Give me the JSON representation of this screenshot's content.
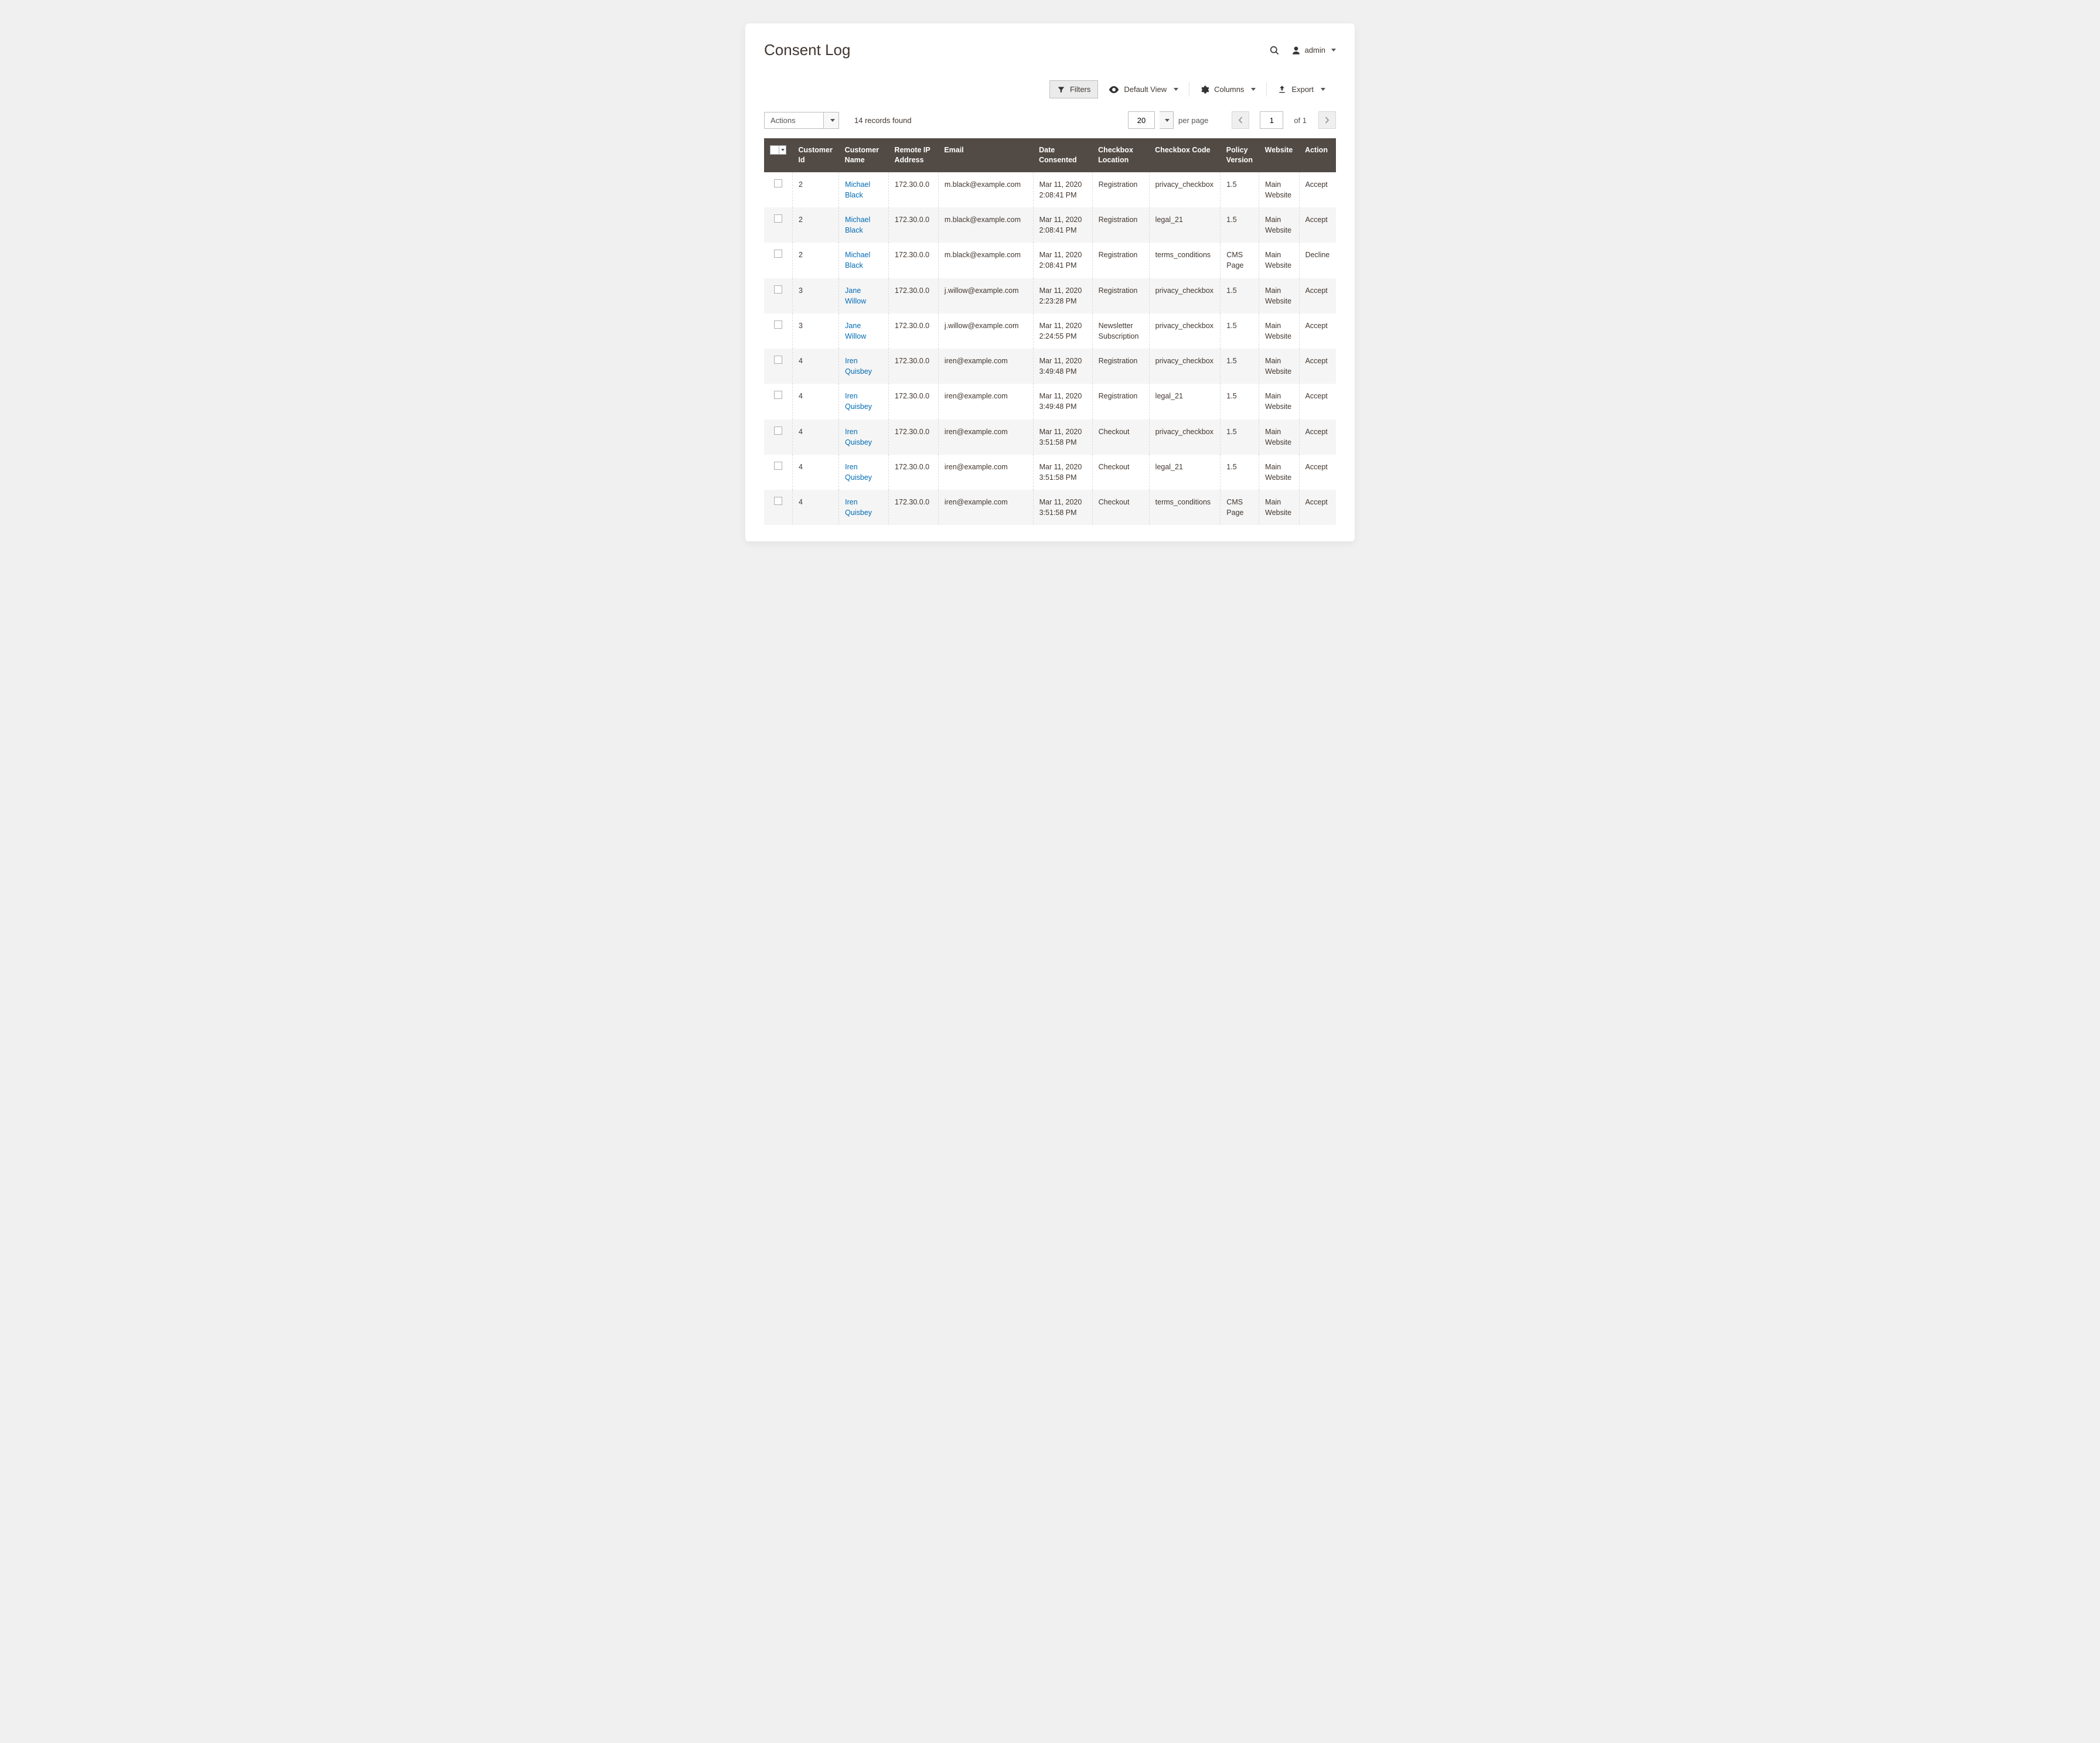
{
  "page_title": "Consent Log",
  "user_label": "admin",
  "toolbar": {
    "filters": "Filters",
    "default_view": "Default View",
    "columns": "Columns",
    "export": "Export"
  },
  "actions": {
    "label": "Actions"
  },
  "records_found": "14 records found",
  "pagination": {
    "per_page_value": "20",
    "per_page_label": "per page",
    "page_value": "1",
    "of_label": "of 1"
  },
  "columns": {
    "select": "",
    "customer_id": "Customer Id",
    "customer_name": "Customer Name",
    "remote_ip": "Remote IP Address",
    "email": "Email",
    "date": "Date Consented",
    "checkbox_location": "Checkbox Location",
    "checkbox_code": "Checkbox Code",
    "policy_version": "Policy Version",
    "website": "Website",
    "action": "Action"
  },
  "rows": [
    {
      "customer_id": "2",
      "customer_name": "Michael Black",
      "remote_ip": "172.30.0.0",
      "email": "m.black@example.com",
      "date": "Mar 11, 2020 2:08:41 PM",
      "checkbox_location": "Registration",
      "checkbox_code": "privacy_checkbox",
      "policy_version": "1.5",
      "website": "Main Website",
      "action": "Accept"
    },
    {
      "customer_id": "2",
      "customer_name": "Michael Black",
      "remote_ip": "172.30.0.0",
      "email": "m.black@example.com",
      "date": "Mar 11, 2020 2:08:41 PM",
      "checkbox_location": "Registration",
      "checkbox_code": "legal_21",
      "policy_version": "1.5",
      "website": "Main Website",
      "action": "Accept"
    },
    {
      "customer_id": "2",
      "customer_name": "Michael Black",
      "remote_ip": "172.30.0.0",
      "email": "m.black@example.com",
      "date": "Mar 11, 2020 2:08:41 PM",
      "checkbox_location": "Registration",
      "checkbox_code": "terms_conditions",
      "policy_version": "CMS Page",
      "website": "Main Website",
      "action": "Decline"
    },
    {
      "customer_id": "3",
      "customer_name": "Jane Willow",
      "remote_ip": "172.30.0.0",
      "email": "j.willow@example.com",
      "date": "Mar 11, 2020 2:23:28 PM",
      "checkbox_location": "Registration",
      "checkbox_code": "privacy_checkbox",
      "policy_version": "1.5",
      "website": "Main Website",
      "action": "Accept"
    },
    {
      "customer_id": "3",
      "customer_name": "Jane Willow",
      "remote_ip": "172.30.0.0",
      "email": "j.willow@example.com",
      "date": "Mar 11, 2020 2:24:55 PM",
      "checkbox_location": "Newsletter Subscription",
      "checkbox_code": "privacy_checkbox",
      "policy_version": "1.5",
      "website": "Main Website",
      "action": "Accept"
    },
    {
      "customer_id": "4",
      "customer_name": "Iren Quisbey",
      "remote_ip": "172.30.0.0",
      "email": "iren@example.com",
      "date": "Mar 11, 2020 3:49:48 PM",
      "checkbox_location": "Registration",
      "checkbox_code": "privacy_checkbox",
      "policy_version": "1.5",
      "website": "Main Website",
      "action": "Accept"
    },
    {
      "customer_id": "4",
      "customer_name": "Iren Quisbey",
      "remote_ip": "172.30.0.0",
      "email": "iren@example.com",
      "date": "Mar 11, 2020 3:49:48 PM",
      "checkbox_location": "Registration",
      "checkbox_code": "legal_21",
      "policy_version": "1.5",
      "website": "Main Website",
      "action": "Accept"
    },
    {
      "customer_id": "4",
      "customer_name": "Iren Quisbey",
      "remote_ip": "172.30.0.0",
      "email": "iren@example.com",
      "date": "Mar 11, 2020 3:51:58 PM",
      "checkbox_location": "Checkout",
      "checkbox_code": "privacy_checkbox",
      "policy_version": "1.5",
      "website": "Main Website",
      "action": "Accept"
    },
    {
      "customer_id": "4",
      "customer_name": "Iren Quisbey",
      "remote_ip": "172.30.0.0",
      "email": "iren@example.com",
      "date": "Mar 11, 2020 3:51:58 PM",
      "checkbox_location": "Checkout",
      "checkbox_code": "legal_21",
      "policy_version": "1.5",
      "website": "Main Website",
      "action": "Accept"
    },
    {
      "customer_id": "4",
      "customer_name": "Iren Quisbey",
      "remote_ip": "172.30.0.0",
      "email": "iren@example.com",
      "date": "Mar 11, 2020 3:51:58 PM",
      "checkbox_location": "Checkout",
      "checkbox_code": "terms_conditions",
      "policy_version": "CMS Page",
      "website": "Main Website",
      "action": "Accept"
    }
  ]
}
